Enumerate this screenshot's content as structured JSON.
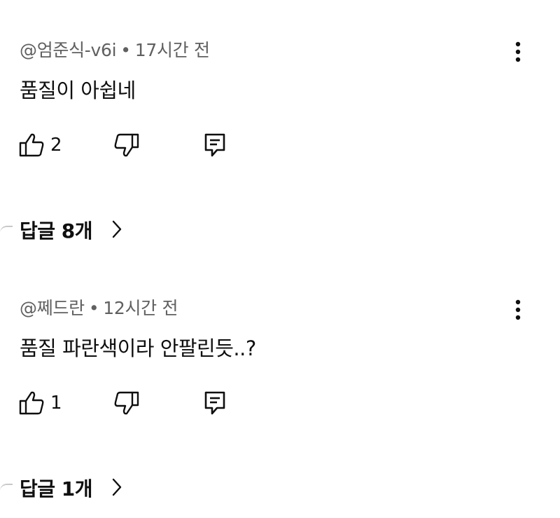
{
  "comments": [
    {
      "author": "@엄준식-v6i",
      "separator": "•",
      "time": "17시간 전",
      "text": "품질이 아쉽네",
      "like_count": "2",
      "replies_label": "답글 8개"
    },
    {
      "author": "@쩨드란",
      "separator": "•",
      "time": "12시간 전",
      "text": "품질 파란색이라 안팔린듯..?",
      "like_count": "1",
      "replies_label": "답글 1개"
    }
  ],
  "icons": {
    "more": "more-vertical-icon",
    "like": "thumbs-up-icon",
    "dislike": "thumbs-down-icon",
    "reply": "comment-reply-icon",
    "chevron": "chevron-right-icon"
  }
}
